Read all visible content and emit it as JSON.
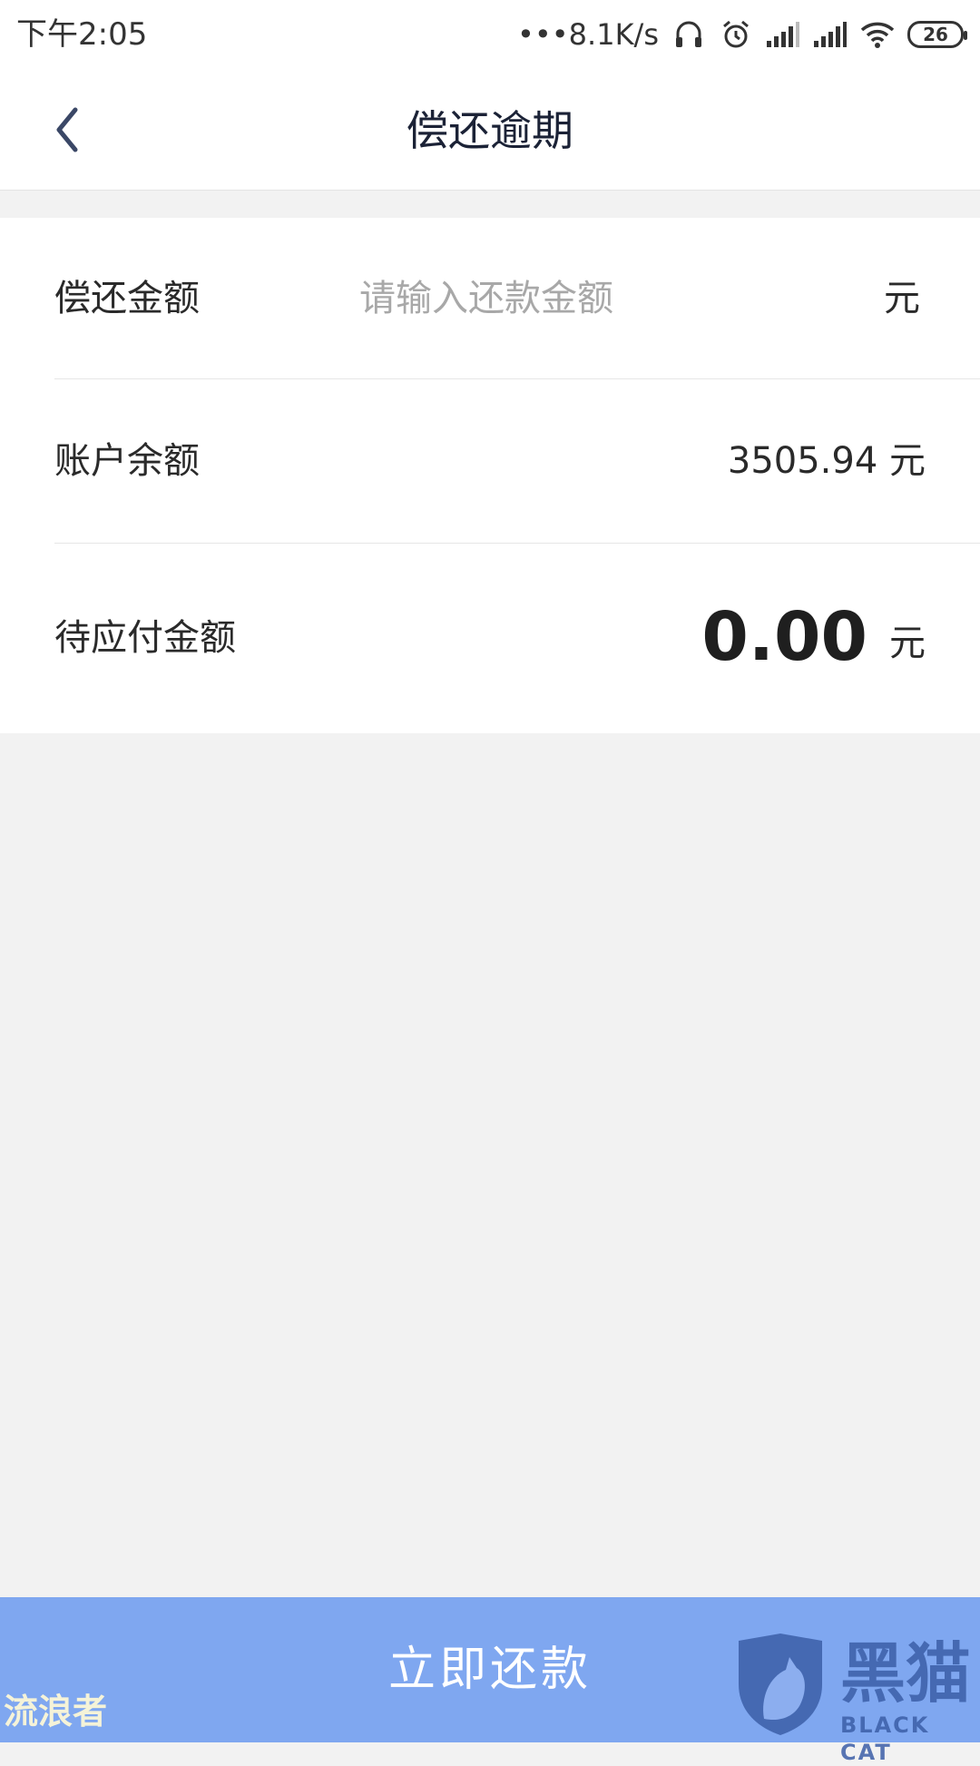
{
  "status_bar": {
    "time": "下午2:05",
    "network_speed": "•••8.1K/s",
    "battery": "26",
    "icons": [
      "headset-icon",
      "alarm-icon",
      "signal-icon",
      "signal-icon",
      "wifi-icon",
      "battery-icon"
    ]
  },
  "header": {
    "title": "偿还逾期",
    "back_icon": "chevron-left-icon"
  },
  "form": {
    "repay_label": "偿还金额",
    "repay_placeholder": "请输入还款金额",
    "repay_value": "",
    "repay_unit": "元",
    "balance_label": "账户余额",
    "balance_value": "3505.94 元",
    "due_label": "待应付金额",
    "due_amount": "0.00",
    "due_unit": "元"
  },
  "actions": {
    "pay_label": "立即还款"
  },
  "watermark": {
    "left_text": "流浪者",
    "brand": "黑猫",
    "brand_sub": "BLACK CAT"
  },
  "colors": {
    "accent": "#7fa7f0",
    "title": "#1b2236",
    "back_icon": "#3a4766",
    "placeholder": "#a8a8a8",
    "page_bg": "#f2f2f2"
  }
}
